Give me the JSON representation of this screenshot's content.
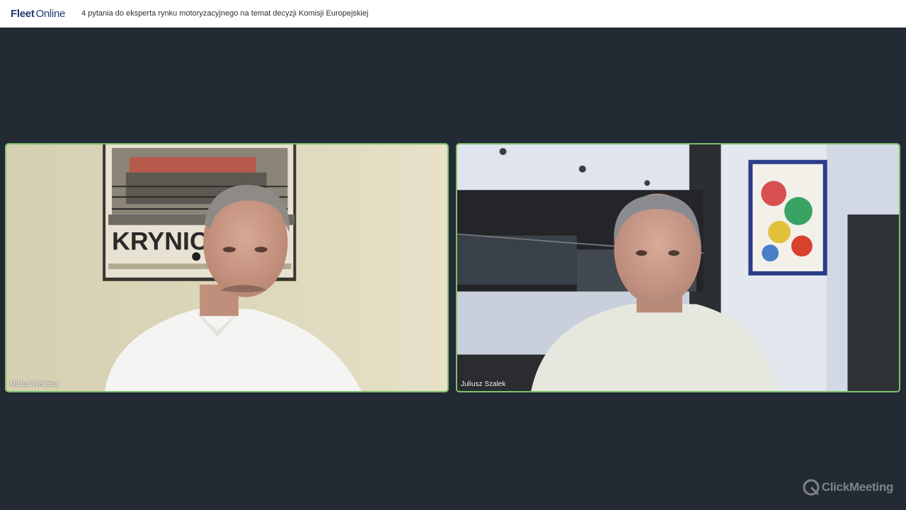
{
  "header": {
    "logo_fleet": "Fleet",
    "logo_online": "Online",
    "title": "4 pytania do eksperta rynku motoryzacyjnego na temat decyzji Komisji Europejskiej"
  },
  "participants": [
    {
      "name": "Michal Wekiera",
      "poster_text": "KRYNICA"
    },
    {
      "name": "Juliusz Szalek"
    }
  ],
  "watermark": {
    "brand": "ClickMeeting",
    "icon": "clickmeeting-logo-icon"
  },
  "colors": {
    "background": "#232a34",
    "tile_border": "#7fbf6a",
    "header_bg": "#ffffff",
    "logo": "#1f3b6e"
  }
}
